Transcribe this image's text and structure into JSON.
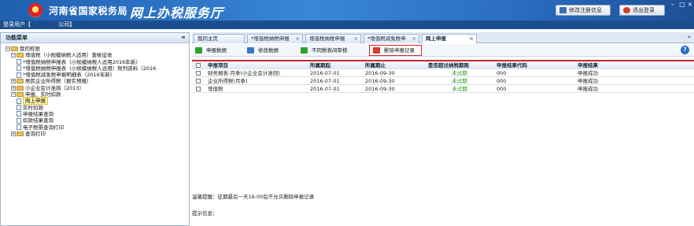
{
  "header": {
    "site_title": "河南省国家税务局",
    "site_subtitle": "网上办税服务厅",
    "modify_info_label": "修改注册信息",
    "logout_label": "退出登录",
    "colors": {
      "header_blue": "#2a6cc0",
      "accent_red": "#d62b2b"
    }
  },
  "userbar": {
    "login_label": "登录用户【",
    "company_suffix": "公司】"
  },
  "left": {
    "title": "功能菜单",
    "collapse_glyph": "«",
    "tree": [
      {
        "label": "我的权限",
        "level": 0,
        "type": "folder",
        "exp": "−"
      },
      {
        "label": "增值税（小规模纳税人适用）查帐征收",
        "level": 1,
        "type": "folder",
        "exp": "−"
      },
      {
        "label": "*增值税纳税申报表（小规模纳税人适用2016年新）",
        "level": 2,
        "type": "doc"
      },
      {
        "label": "*增值税纳税申报表（小规模纳税人适用）附列资料（2016",
        "level": 2,
        "type": "doc"
      },
      {
        "label": "*增值税减免税申报明细表（2016年新）",
        "level": 2,
        "type": "doc"
      },
      {
        "label": "居民企业所得税（据实预缴）",
        "level": 1,
        "type": "folder",
        "exp": "+"
      },
      {
        "label": "小企业会计准则（2013）",
        "level": 1,
        "type": "folder",
        "exp": "+"
      },
      {
        "label": "申报、实时扣款",
        "level": 1,
        "type": "folder",
        "exp": "−"
      },
      {
        "label": "网上申报",
        "level": 2,
        "type": "doc",
        "selected": true
      },
      {
        "label": "实时扣款",
        "level": 2,
        "type": "doc"
      },
      {
        "label": "申报结果查询",
        "level": 2,
        "type": "doc"
      },
      {
        "label": "扣款结果查询",
        "level": 2,
        "type": "doc"
      },
      {
        "label": "电子税票查询打印",
        "level": 2,
        "type": "doc"
      },
      {
        "label": "查询打印",
        "level": 1,
        "type": "folder",
        "exp": "+"
      }
    ]
  },
  "tabs": [
    {
      "label": "我的主页",
      "active": false
    },
    {
      "label": "*增值税纳税申报",
      "active": false
    },
    {
      "label": "增值税纳税申报",
      "active": false
    },
    {
      "label": "*增值税减免税申",
      "active": false
    },
    {
      "label": "网上申报",
      "active": true
    }
  ],
  "tab_more": "»",
  "toolbar": {
    "declare": "申报数据",
    "modify": "修改数据",
    "no_sync": "不同税表间审核",
    "delete": "删除申报记录",
    "help": "?"
  },
  "table": {
    "headers": [
      "申报项目",
      "所属期起",
      "所属期止",
      "是否超过纳税期限",
      "申报结果代码",
      "申报结果"
    ],
    "rows": [
      [
        "财务报表-月季(小企业会计准则)",
        "2016-07-01",
        "2016-09-30",
        "未过期",
        "000",
        "申报成功"
      ],
      [
        "企业所得税(月季)",
        "2016-07-01",
        "2016-09-30",
        "未过期",
        "000",
        "申报成功"
      ],
      [
        "增值税",
        "2016-07-01",
        "2016-09-30",
        "未过期",
        "000",
        "申报成功"
      ]
    ]
  },
  "notes": {
    "reminder": "温馨提醒：征期最后一天16:00后不允许删除申报记录",
    "tip": "提示信息："
  }
}
